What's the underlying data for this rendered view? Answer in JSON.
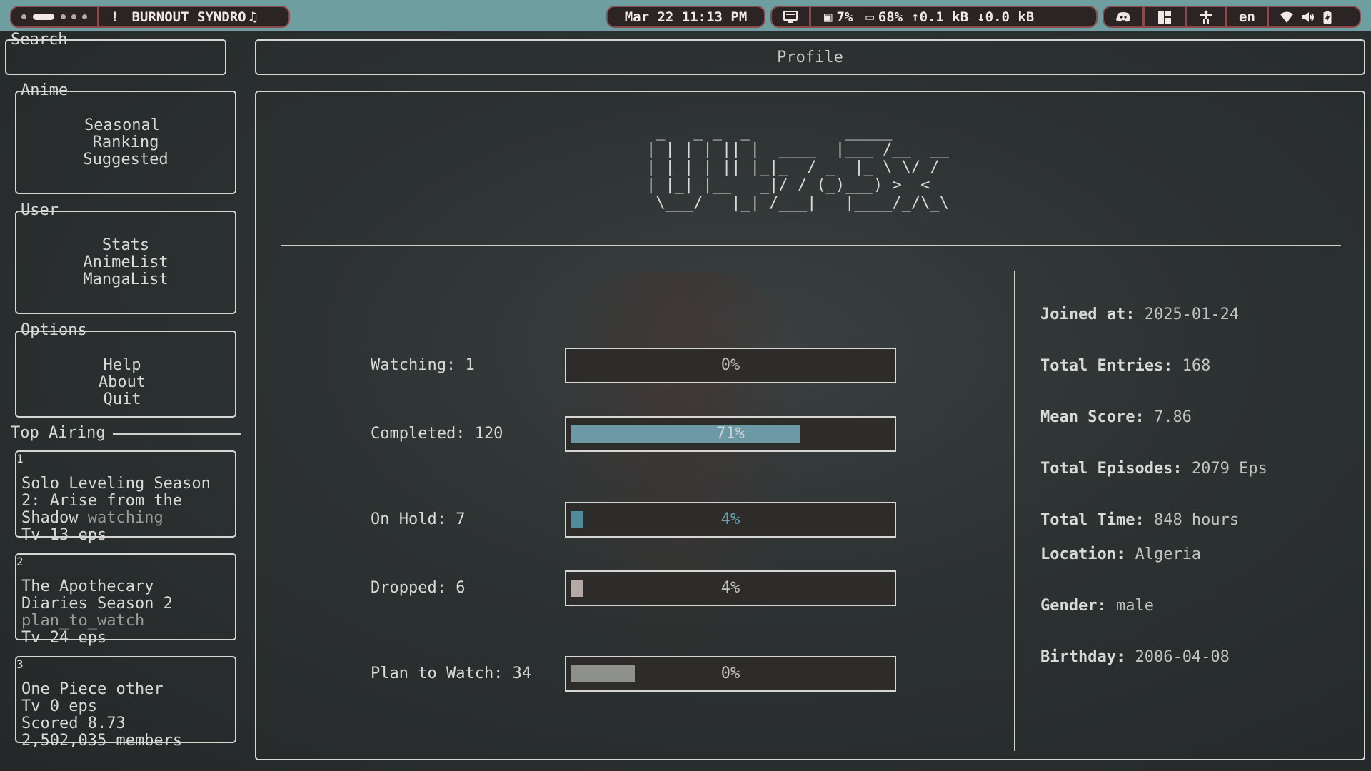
{
  "topbar": {
    "window_title": "BURNOUT SYNDRO",
    "warning_glyph": "!",
    "music_icon": "music-note-icon",
    "datetime": "Mar 22 11:13 PM",
    "cpu": "7%",
    "memory": "68%",
    "upload": "0.1 kB",
    "download": "0.0 kB",
    "language": "en"
  },
  "search": {
    "label": "Search",
    "value": ""
  },
  "header": {
    "title": "Profile"
  },
  "sidebar": {
    "anime": {
      "label": "Anime",
      "items": [
        "Seasonal",
        "Ranking",
        "Suggested"
      ]
    },
    "user": {
      "label": "User",
      "items": [
        "Stats",
        "AnimeList",
        "MangaList"
      ]
    },
    "options": {
      "label": "Options",
      "items": [
        "Help",
        "About",
        "Quit"
      ]
    },
    "top_airing": {
      "label": "Top Airing",
      "entries": [
        {
          "rank": "1",
          "lines": [
            "Solo Leveling Season",
            "2: Arise from the",
            "Shadow"
          ],
          "status": "watching",
          "meta": "Tv 13 eps"
        },
        {
          "rank": "2",
          "lines": [
            "The Apothecary",
            "Diaries Season 2"
          ],
          "status": "plan_to_watch",
          "meta": "Tv 24 eps"
        },
        {
          "rank": "3",
          "lines": [
            "One Piece other",
            "Tv 0 eps",
            "Scored 8.73",
            "2,502,035 members"
          ],
          "status": "",
          "meta": ""
        }
      ]
    }
  },
  "profile": {
    "username_ascii": " _   _ _  _          _____      \n| | | | || |  ____  |___ /__  __\n| | | | || |_|_  / _  |_ \\ \\/ /\n| |_| |__   _|/ / (_)___) >  < \n \\___/   |_| /___|   |____/_/\\_\\",
    "username": "U4z3x",
    "stats": [
      {
        "label": "Watching: 1",
        "percent": "0%",
        "fill": 0.0,
        "fill_color": "#4f8b99",
        "pct_color": "#b8bab6"
      },
      {
        "label": "Completed: 120",
        "percent": "71%",
        "fill": 0.71,
        "fill_color": "#6d98a6",
        "pct_color": "#c8d3d6"
      },
      {
        "label": "On Hold: 7",
        "percent": "4%",
        "fill": 0.04,
        "fill_color": "#4f8b99",
        "pct_color": "#6fa1b0"
      },
      {
        "label": "Dropped: 6",
        "percent": "4%",
        "fill": 0.04,
        "fill_color": "#b5a9a6",
        "pct_color": "#c2c4c0"
      },
      {
        "label": "Plan to Watch: 34",
        "percent": "0%",
        "fill": 0.2,
        "fill_color": "#8e908b",
        "pct_color": "#c2c4c0"
      }
    ],
    "info": [
      {
        "key": "Joined at:",
        "value": "2025-01-24"
      },
      {
        "key": "Total Entries:",
        "value": "168"
      },
      {
        "key": "Mean Score:",
        "value": "7.86"
      },
      {
        "key": "Total Episodes:",
        "value": "2079 Eps"
      },
      {
        "key": "Total Time:",
        "value": " 848 hours"
      },
      {
        "key": "Location:",
        "value": "Algeria"
      },
      {
        "key": "Gender:",
        "value": "male"
      },
      {
        "key": "Birthday:",
        "value": "2006-04-08"
      }
    ]
  }
}
